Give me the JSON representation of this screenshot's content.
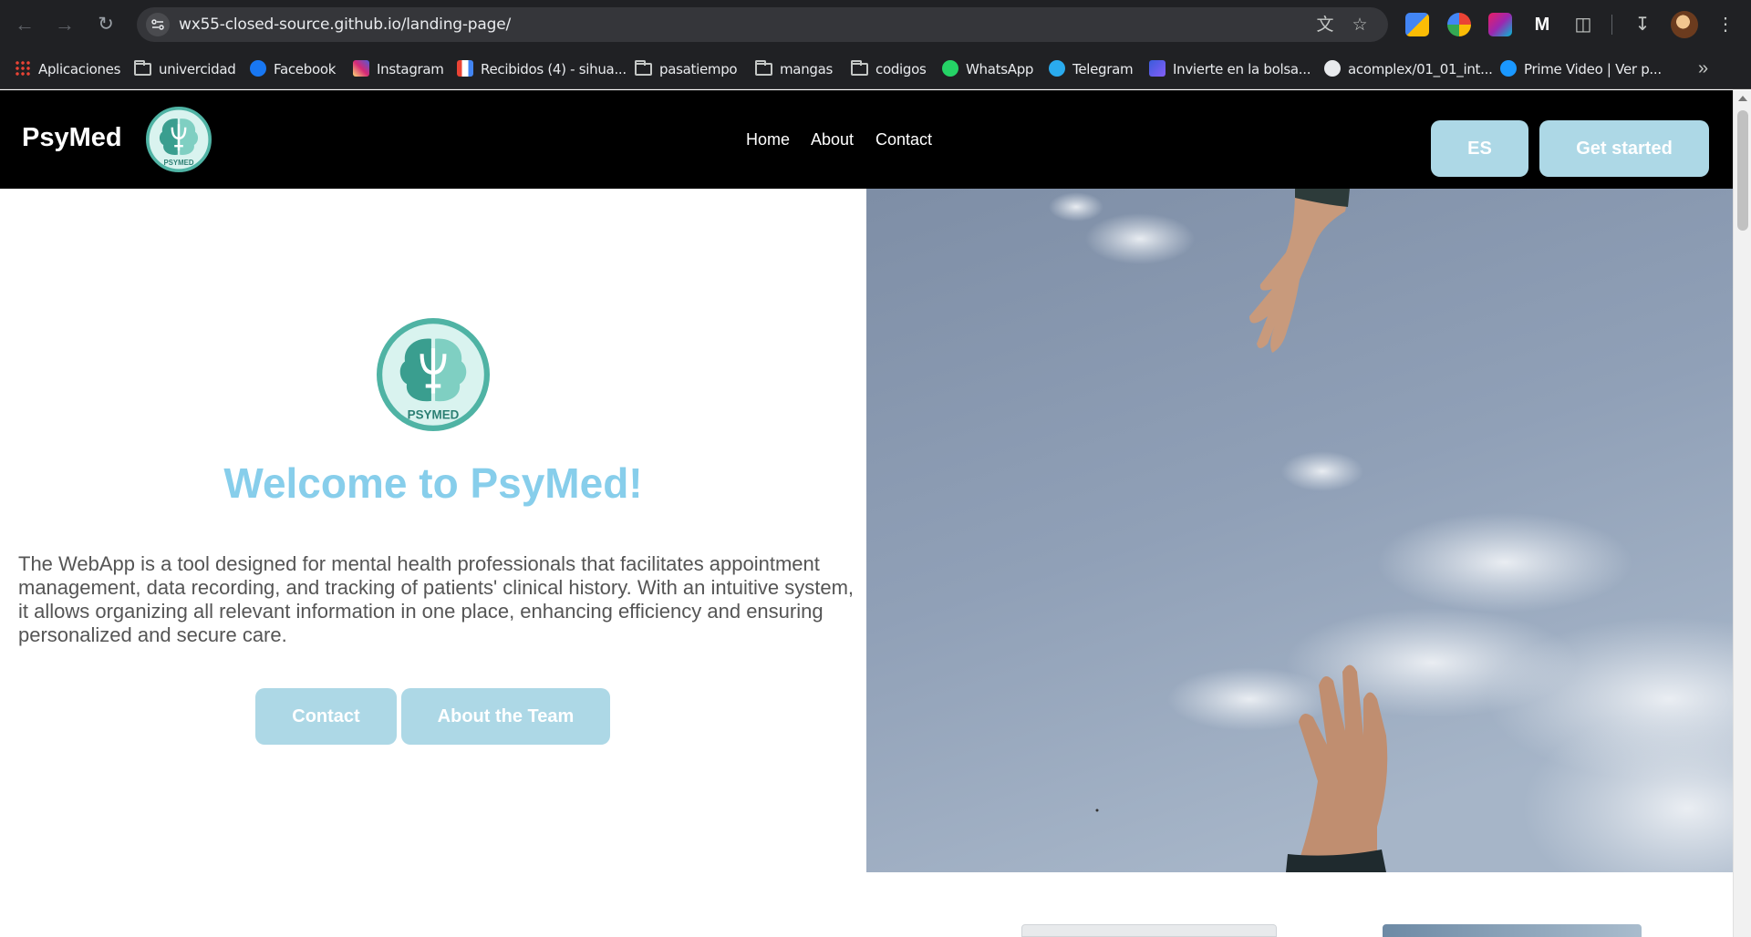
{
  "browser": {
    "url": "wx55-closed-source.github.io/landing-page/",
    "bookmarks": [
      {
        "label": "Aplicaciones",
        "icon": "apps-grid-icon"
      },
      {
        "label": "univercidad",
        "icon": "folder-icon"
      },
      {
        "label": "Facebook",
        "icon": "facebook-icon"
      },
      {
        "label": "Instagram",
        "icon": "instagram-icon"
      },
      {
        "label": "Recibidos (4) - sihua...",
        "icon": "gmail-icon"
      },
      {
        "label": "pasatiempo",
        "icon": "folder-icon"
      },
      {
        "label": "mangas",
        "icon": "folder-icon"
      },
      {
        "label": "codigos",
        "icon": "folder-icon"
      },
      {
        "label": "WhatsApp",
        "icon": "whatsapp-icon"
      },
      {
        "label": "Telegram",
        "icon": "telegram-icon"
      },
      {
        "label": "Invierte en la bolsa...",
        "icon": "broker-icon"
      },
      {
        "label": "acomplex/01_01_int...",
        "icon": "github-icon"
      },
      {
        "label": "Prime Video | Ver p...",
        "icon": "prime-video-icon"
      }
    ]
  },
  "header": {
    "brand": "PsyMed",
    "nav": [
      "Home",
      "About",
      "Contact"
    ],
    "lang_button": "ES",
    "cta_button": "Get started"
  },
  "hero": {
    "logo_text": "PSYMED",
    "title": "Welcome to PsyMed!",
    "description": "The WebApp is a tool designed for mental health professionals that facilitates appointment management, data recording, and tracking of patients' clinical history. With an intuitive system, it allows organizing all relevant information in one place, enhancing efficiency and ensuring personalized and secure care.",
    "buttons": [
      "Contact",
      "About the Team"
    ]
  },
  "colors": {
    "button_bg": "#add8e6",
    "title": "#87ceeb",
    "logo_teal": "#3a9e8f",
    "logo_light": "#d9f3ef"
  }
}
